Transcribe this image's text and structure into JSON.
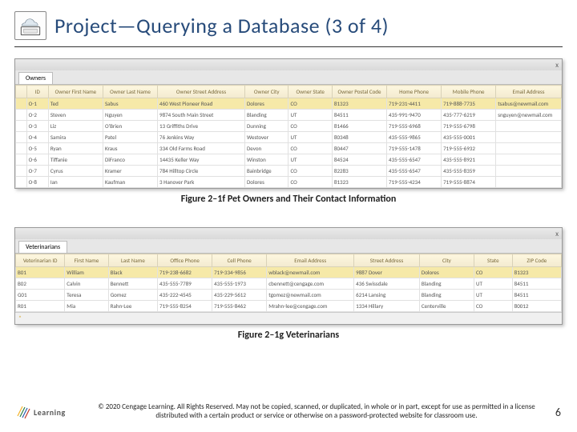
{
  "title": "Project—Querying a Database (3 of 4)",
  "figure1": {
    "tab": "Owners",
    "close": "x",
    "headers": [
      "",
      "ID",
      "Owner First Name",
      "Owner Last Name",
      "Owner Street Address",
      "Owner City",
      "Owner State",
      "Owner Postal Code",
      "Home Phone",
      "Mobile Phone",
      "Email Address"
    ],
    "rows": [
      [
        "",
        "O-1",
        "Ted",
        "Sabus",
        "460 West Pioneer Road",
        "Dolores",
        "CO",
        "81323",
        "719-231-4411",
        "719-888-7735",
        "tsabus@newmail.com"
      ],
      [
        "",
        "O-2",
        "Steven",
        "Nguyen",
        "9874 South Main Street",
        "Blanding",
        "UT",
        "84511",
        "435-991-9470",
        "435-777-6219",
        "snguyen@newmail.com"
      ],
      [
        "",
        "O-3",
        "Liz",
        "O'Brien",
        "13 Griffiths Drive",
        "Dunning",
        "CO",
        "81466",
        "719-555-6968",
        "719-555-6798",
        ""
      ],
      [
        "",
        "O-4",
        "Samira",
        "Patel",
        "76 Jenkins Way",
        "Westover",
        "UT",
        "80348",
        "435-555-9865",
        "435-555-0001",
        ""
      ],
      [
        "",
        "O-5",
        "Ryan",
        "Kraus",
        "334 Old Farms Road",
        "Devon",
        "CO",
        "80447",
        "719-555-1478",
        "719-555-6932",
        ""
      ],
      [
        "",
        "O-6",
        "Tiffanie",
        "DiFranco",
        "14435 Keller Way",
        "Winston",
        "UT",
        "84524",
        "435-555-6547",
        "435-555-8921",
        ""
      ],
      [
        "",
        "O-7",
        "Cyrus",
        "Kramer",
        "784 Hilltop Circle",
        "Bainbridge",
        "CO",
        "82283",
        "435-555-6547",
        "435-555-8359",
        ""
      ],
      [
        "",
        "O-8",
        "Ian",
        "Kaufman",
        "3 Hanover Park",
        "Dolores",
        "CO",
        "81323",
        "719-555-4234",
        "719-555-8874",
        ""
      ]
    ],
    "caption": "Figure 2–1f Pet Owners and Their Contact Information"
  },
  "figure2": {
    "tab": "Veterinarians",
    "close": "x",
    "headers": [
      "Veterinarian ID",
      "First Name",
      "Last Name",
      "Office Phone",
      "Cell Phone",
      "Email Address",
      "Street Address",
      "City",
      "State",
      "ZIP Code"
    ],
    "rows": [
      [
        "B01",
        "William",
        "Black",
        "719-238-6682",
        "719-334-9856",
        "wblack@newmail.com",
        "9887 Dover",
        "Dolores",
        "CO",
        "81323"
      ],
      [
        "B02",
        "Calvin",
        "Bennett",
        "435-555-7789",
        "435-555-1973",
        "cbennett@cengage.com",
        "436 Swissdale",
        "Blanding",
        "UT",
        "84511"
      ],
      [
        "G01",
        "Teresa",
        "Gomez",
        "435-222-4545",
        "435-229-5612",
        "tgomez@newmail.com",
        "6214 Lansing",
        "Blanding",
        "UT",
        "84511"
      ],
      [
        "R01",
        "Mia",
        "Rahn-Lee",
        "719-555-8254",
        "719-555-8462",
        "Mrahn-lee@cengage.com",
        "1334 Hillary",
        "Centerville",
        "CO",
        "80012"
      ]
    ],
    "nav": "*",
    "caption": "Figure 2–1g Veterinarians"
  },
  "footer": {
    "brand": "Learning",
    "text": "© 2020 Cengage Learning. All Rights Reserved. May not be copied, scanned, or duplicated, in whole or in part, except for use as permitted in a license distributed with a certain product or service or otherwise on a password-protected website for classroom use.",
    "page": "6"
  }
}
